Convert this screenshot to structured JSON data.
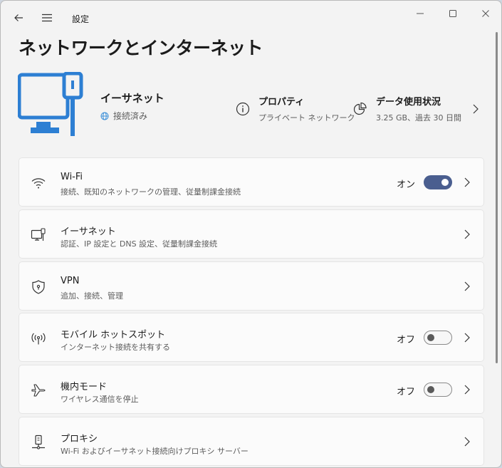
{
  "app": {
    "title": "設定"
  },
  "page": {
    "title": "ネットワークとインターネット"
  },
  "hero": {
    "name": "イーサネット",
    "status": "接続済み",
    "properties": {
      "title": "プロパティ",
      "subtitle": "プライベート ネットワーク"
    },
    "data_usage": {
      "title": "データ使用状況",
      "subtitle": "3.25 GB、過去 30 日間"
    }
  },
  "items": [
    {
      "title": "Wi-Fi",
      "desc": "接続、既知のネットワークの管理、従量制課金接続",
      "toggle_label": "オン",
      "toggle": "on",
      "icon": "wifi-icon"
    },
    {
      "title": "イーサネット",
      "desc": "認証、IP 設定と DNS 設定、従量制課金接続",
      "icon": "ethernet-icon"
    },
    {
      "title": "VPN",
      "desc": "追加、接続、管理",
      "icon": "vpn-shield-icon"
    },
    {
      "title": "モバイル ホットスポット",
      "desc": "インターネット接続を共有する",
      "toggle_label": "オフ",
      "toggle": "off",
      "icon": "hotspot-icon"
    },
    {
      "title": "機内モード",
      "desc": "ワイヤレス通信を停止",
      "toggle_label": "オフ",
      "toggle": "off",
      "icon": "airplane-icon"
    },
    {
      "title": "プロキシ",
      "desc": "Wi-Fi およびイーサネット接続向けプロキシ サーバー",
      "icon": "proxy-icon"
    }
  ],
  "colors": {
    "accent": "#4a5e8f",
    "hero_icon": "#2d7fd3",
    "status_globe": "#3a8fd8"
  }
}
